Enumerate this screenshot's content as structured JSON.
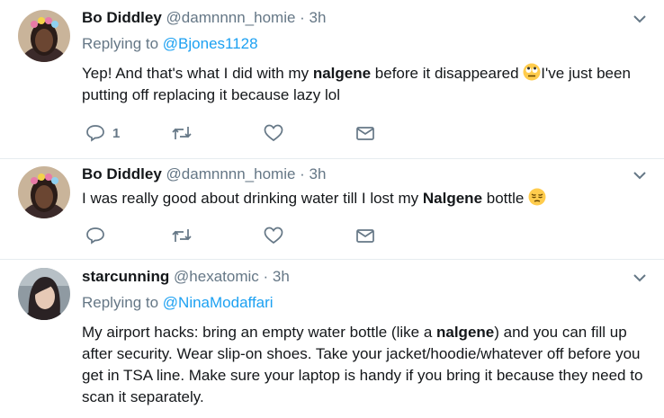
{
  "tweets": [
    {
      "name": "Bo Diddley",
      "handle": "@damnnnn_homie",
      "time": "3h",
      "replying_prefix": "Replying to ",
      "replying_to": "@Bjones1128",
      "text_1": "Yep! And that's what I did with my ",
      "bold_1": "nalgene",
      "text_2": " before it disappeared ",
      "emoji": "face-with-rolling-eyes",
      "text_3": "I've just been putting off replacing it because lazy lol",
      "reply_count": "1"
    },
    {
      "name": "Bo Diddley",
      "handle": "@damnnnn_homie",
      "time": "3h",
      "text_1": "I was really good about drinking water till I lost my ",
      "bold_1": "Nalgene",
      "text_2": " bottle ",
      "emoji": "pensive-face"
    },
    {
      "name": "starcunning",
      "handle": "@hexatomic",
      "time": "3h",
      "replying_prefix": "Replying to ",
      "replying_to": "@NinaModaffari",
      "text_1": "My airport hacks: bring an empty water bottle (like a ",
      "bold_1": "nalgene",
      "text_2": ") and you can fill up after security. Wear slip-on shoes. Take your jacket/hoodie/whatever off before you get in TSA line. Make sure your laptop is handy if you bring it because they need to scan it separately."
    }
  ],
  "separator": " · ",
  "colors": {
    "link": "#1da1f2",
    "muted": "#657786",
    "divider": "#e6ecf0"
  }
}
